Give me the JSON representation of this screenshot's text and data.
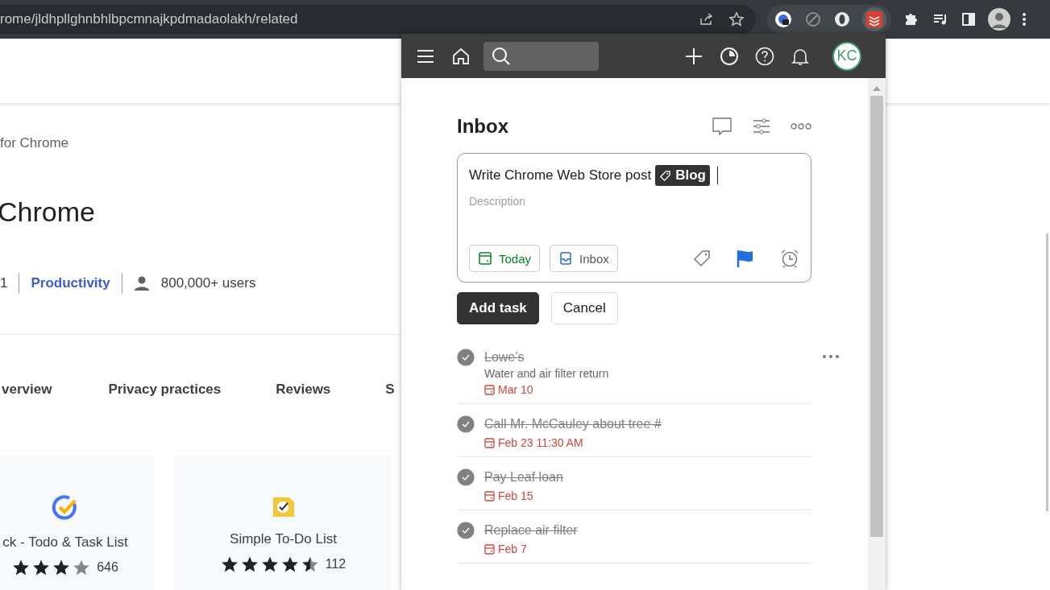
{
  "browser": {
    "url": "rome/jldhpllghnbhlbpcmnajkpdmadaolakh/related"
  },
  "store": {
    "subtitle": "for Chrome",
    "title": "Chrome",
    "rating_fragment": "1",
    "category": "Productivity",
    "users": "800,000+ users",
    "tabs": [
      {
        "label": "verview"
      },
      {
        "label": "Privacy practices"
      },
      {
        "label": "Reviews"
      },
      {
        "label": "S"
      }
    ],
    "cards": [
      {
        "name": "ck - Todo & Task List",
        "stars": 3,
        "count": "646"
      },
      {
        "name": "Simple To-Do List",
        "stars": 4.5,
        "count": "112"
      }
    ]
  },
  "popup": {
    "avatar": "KC",
    "title": "Inbox",
    "editor": {
      "value": "Write Chrome Web Store post",
      "label": "Blog",
      "placeholder": "Description",
      "chips": [
        {
          "label": "Today",
          "kind": "date"
        },
        {
          "label": "Inbox",
          "kind": "project"
        }
      ]
    },
    "buttons": [
      {
        "label": "Add task",
        "kind": "primary"
      },
      {
        "label": "Cancel",
        "kind": "secondary"
      }
    ],
    "tasks": [
      {
        "title": "Lowe’s",
        "description": "Water and air filter return",
        "due": "Mar 10",
        "done": true,
        "hovered": true
      },
      {
        "title": "Call Mr. McCauley about tree #",
        "due": "Feb 23 11:30 AM",
        "done": true,
        "hovered": false
      },
      {
        "title": "Pay Leaf loan",
        "due": "Feb 15",
        "done": true,
        "hovered": false
      },
      {
        "title": "Replace air filter",
        "due": "Feb 7",
        "done": true,
        "hovered": false
      }
    ]
  }
}
